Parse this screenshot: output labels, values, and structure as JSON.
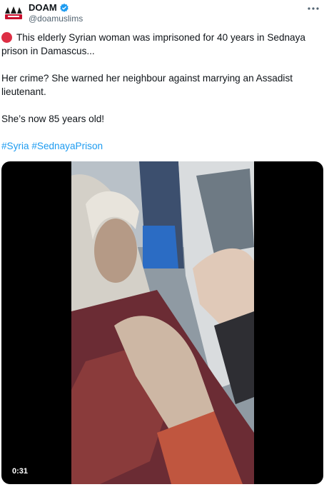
{
  "author": {
    "display_name": "DOAM",
    "handle": "@doamuslims",
    "avatar_icon": "doam-logo-icon",
    "verified_icon": "verified-badge-icon"
  },
  "more_icon": "more-options-icon",
  "post": {
    "line1": "This elderly Syrian woman was imprisoned for 40 years in Sednaya prison in Damascus...",
    "line2": "Her crime? She warned her neighbour against marrying an Assadist lieutenant.",
    "line3": "She’s now 85 years old!",
    "hashtags": [
      "#Syria",
      "#SednayaPrison"
    ]
  },
  "video": {
    "duration": "0:31"
  },
  "colors": {
    "link": "#1d9bf0",
    "verified": "#1d9bf0",
    "alert_dot": "#dd2e44"
  }
}
